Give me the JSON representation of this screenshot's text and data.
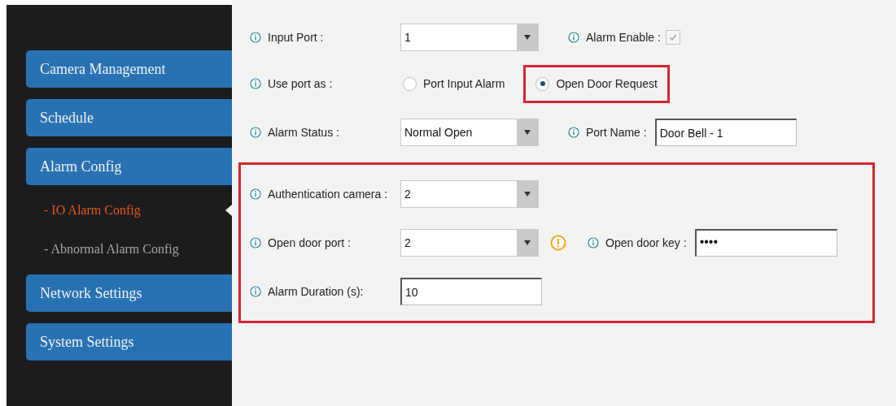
{
  "sidebar": {
    "items": [
      {
        "label": "Camera Management",
        "kind": "main",
        "selected": false
      },
      {
        "label": "Schedule",
        "kind": "main",
        "selected": false
      },
      {
        "label": "Alarm Config",
        "kind": "main",
        "selected": false
      },
      {
        "label": "- IO Alarm Config",
        "kind": "sub",
        "selected": true
      },
      {
        "label": "- Abnormal Alarm Config",
        "kind": "sub",
        "selected": false
      },
      {
        "label": "Network Settings",
        "kind": "main",
        "selected": false
      },
      {
        "label": "System Settings",
        "kind": "main",
        "selected": false
      }
    ]
  },
  "form": {
    "sections": [
      {
        "highlighted": false,
        "rows": [
          {
            "fields": [
              {
                "kind": "select",
                "label": "Input Port :",
                "value": "1"
              },
              {
                "kind": "checkbox",
                "label": "Alarm Enable :",
                "checked": true,
                "disabled": true
              }
            ]
          },
          {
            "fields": [
              {
                "kind": "radio_group",
                "label": "Use port as :",
                "options": [
                  {
                    "label": "Port Input Alarm",
                    "selected": false
                  },
                  {
                    "label": "Open Door Request",
                    "selected": true,
                    "highlighted": true
                  }
                ]
              }
            ]
          },
          {
            "fields": [
              {
                "kind": "select",
                "label": "Alarm Status :",
                "value": "Normal Open"
              },
              {
                "kind": "text",
                "label": "Port Name :",
                "value": "Door Bell - 1"
              }
            ]
          }
        ]
      },
      {
        "highlighted": true,
        "rows": [
          {
            "fields": [
              {
                "kind": "select",
                "label": "Authentication camera :",
                "value": "2"
              }
            ]
          },
          {
            "fields": [
              {
                "kind": "select",
                "label": "Open door port :",
                "value": "2",
                "warning": true
              },
              {
                "kind": "password",
                "label": "Open door key :",
                "value": "••••"
              }
            ]
          },
          {
            "fields": [
              {
                "kind": "text",
                "label": "Alarm Duration (s):",
                "value": "10"
              }
            ]
          }
        ]
      }
    ]
  }
}
